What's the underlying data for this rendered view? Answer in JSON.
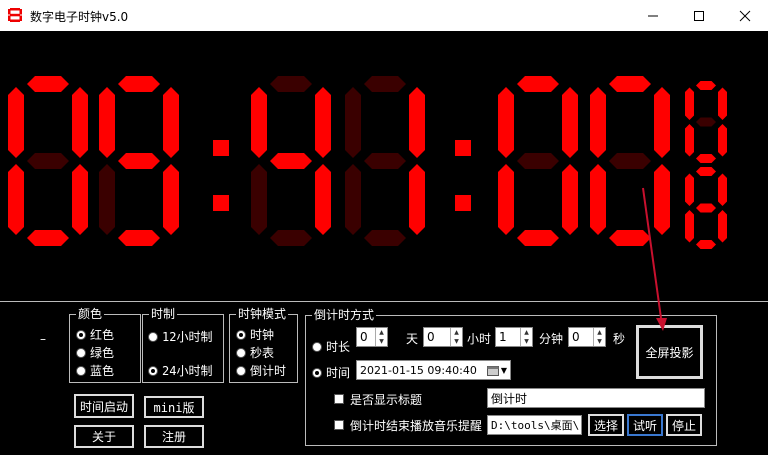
{
  "window": {
    "title": "数字电子时钟v5.0",
    "minimize_icon": "minimize-icon",
    "maximize_icon": "maximize-icon",
    "close_icon": "close-icon"
  },
  "clock": {
    "digit_color": "#ff0000",
    "unlit_color": "#3a0000",
    "big_digits": [
      "09",
      "41",
      "00"
    ],
    "small_digits": [
      "0",
      "8"
    ]
  },
  "color_group": {
    "title": "颜色",
    "options": [
      "红色",
      "绿色",
      "蓝色"
    ]
  },
  "format_group": {
    "title": "时制",
    "options": [
      "12小时制",
      "24小时制"
    ]
  },
  "mode_group": {
    "title": "时钟模式",
    "options": [
      "时钟",
      "秒表",
      "倒计时"
    ]
  },
  "dash": "–",
  "buttons": {
    "time_start": "时间启动",
    "mini": "mini版",
    "about": "关于",
    "register": "注册",
    "fullscreen": "全屏投影"
  },
  "countdown": {
    "title": "倒计时方式",
    "duration_label": "时长",
    "day_value": "0",
    "day_unit": "天",
    "hour_value": "0",
    "hour_unit": "小时",
    "minute_value": "1",
    "minute_unit": "分钟",
    "second_value": "0",
    "second_unit": "秒",
    "time_label": "时间",
    "time_value": "2021-01-15  09:40:40",
    "show_title_label": "是否显示标题",
    "title_value": "倒计时",
    "music_label": "倒计时结束播放音乐提醒",
    "music_path": "D:\\tools\\桌面\\",
    "select_button": "选择",
    "listen_button": "试听",
    "stop_button": "停止"
  }
}
